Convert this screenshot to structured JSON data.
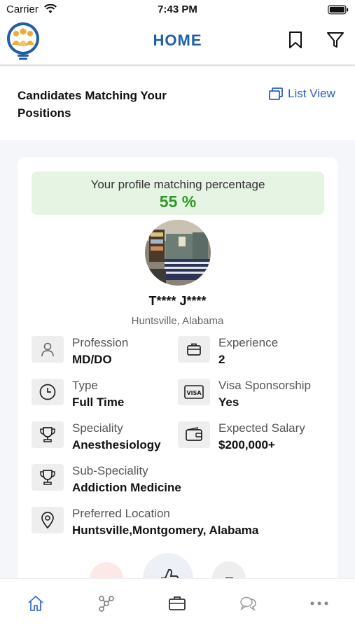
{
  "status_bar": {
    "carrier": "Carrier",
    "time": "7:43 PM"
  },
  "header": {
    "title": "HOME"
  },
  "section": {
    "title": "Candidates Matching Your Positions",
    "list_view_label": "List View"
  },
  "match": {
    "label": "Your profile matching percentage",
    "value": "55 %"
  },
  "candidate": {
    "name": "T**** J****",
    "location": "Huntsville, Alabama",
    "fields": {
      "profession": {
        "label": "Profession",
        "value": "MD/DO"
      },
      "experience": {
        "label": "Experience",
        "value": "2"
      },
      "type": {
        "label": "Type",
        "value": "Full Time"
      },
      "visa": {
        "label": "Visa Sponsorship",
        "value": "Yes"
      },
      "speciality": {
        "label": "Speciality",
        "value": "Anesthesiology"
      },
      "salary": {
        "label": "Expected Salary",
        "value": "$200,000+"
      },
      "sub_speciality": {
        "label": "Sub-Speciality",
        "value": "Addiction Medicine"
      },
      "preferred_location": {
        "label": "Preferred Location",
        "value": "Huntsville,Montgomery, Alabama"
      }
    }
  },
  "icons": {
    "profession": "user-icon",
    "experience": "briefcase-icon",
    "type": "clock-icon",
    "visa": "visa-card-icon",
    "speciality": "trophy-icon",
    "salary": "wallet-icon",
    "sub_speciality": "trophy-icon",
    "preferred_location": "location-pin-icon"
  },
  "bottom_nav": [
    "home-icon",
    "network-icon",
    "briefcase-icon",
    "chat-icon",
    "more-icon"
  ],
  "colors": {
    "brand_blue": "#1f5fa8",
    "link_blue": "#2a5fc0",
    "match_green": "#2d9a28",
    "match_bg": "#e6f4e4",
    "nav_active": "#3a6fd8"
  }
}
